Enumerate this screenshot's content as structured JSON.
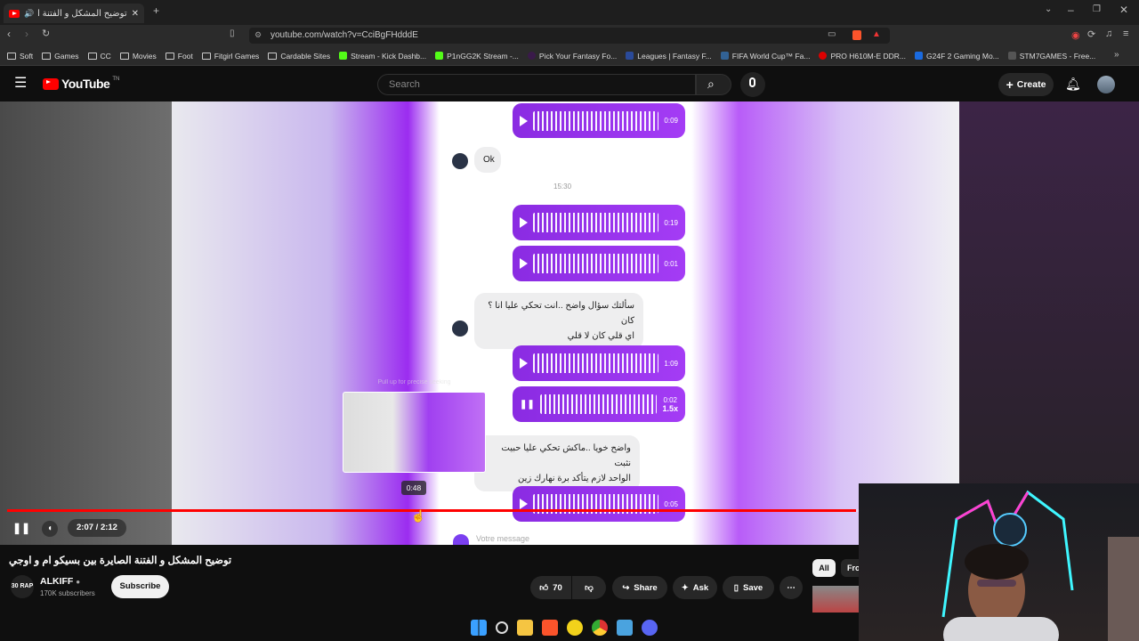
{
  "browser": {
    "tab_title": "توضيح المشكل و الفتنة الصايرة",
    "url": "youtube.com/watch?v=CciBgFHdddE",
    "bookmarks": [
      {
        "label": "Soft",
        "icon": "folder-icon"
      },
      {
        "label": "Games",
        "icon": "folder-icon"
      },
      {
        "label": "CC",
        "icon": "folder-icon"
      },
      {
        "label": "Movies",
        "icon": "folder-icon"
      },
      {
        "label": "Foot",
        "icon": "folder-icon"
      },
      {
        "label": "Fitgirl Games",
        "icon": "folder-icon"
      },
      {
        "label": "Cardable Sites",
        "icon": "folder-icon"
      },
      {
        "label": "Stream - Kick Dashb...",
        "icon": "kick-icon"
      },
      {
        "label": "P1nGG2K Stream -...",
        "icon": "kick-icon"
      },
      {
        "label": "Pick Your Fantasy Fo...",
        "icon": "site-icon"
      },
      {
        "label": "Leagues | Fantasy F...",
        "icon": "site-icon"
      },
      {
        "label": "FIFA World Cup™ Fa...",
        "icon": "fifa-icon"
      },
      {
        "label": "PRO H610M-E DDR...",
        "icon": "msi-icon"
      },
      {
        "label": "G24F 2 Gaming Mo...",
        "icon": "site-icon"
      },
      {
        "label": "STM7GAMES - Free...",
        "icon": "site-icon"
      }
    ]
  },
  "youtube": {
    "logo_text": "YouTube",
    "logo_region": "TN",
    "search_placeholder": "Search",
    "create_label": "Create"
  },
  "video": {
    "messages": {
      "audio_durations": [
        "0:09",
        "0:19",
        "0:01",
        "1:09",
        "0:02",
        "0:05"
      ],
      "speed": "1.5x",
      "ok_text": "Ok",
      "timestamp": "15:30",
      "msg1_line1": "سألتك سؤال واضح ..انت تحكي عليا انا ؟ كان",
      "msg1_line2": "اي قلي كان لا قلي",
      "msg2_line1": "واضح خويا ..ماكش تحكي عليا حبيت نثبت",
      "msg2_line2": "الواحد لازم يتأكد برة نهارك زين",
      "input_placeholder": "Votre message"
    },
    "preview_tip": "Pull up for precise seeking",
    "preview_time": "0:48",
    "time_display": "2:07 / 2:12",
    "progress_fraction": 0.755
  },
  "info": {
    "title": "توضيح المشكل و الفتنة الصايرة بين بسيكو ام و اوجي",
    "channel_name": "ALKIFF",
    "channel_avatar_text": "30 RAP",
    "subscribers": "170K subscribers",
    "subscribe_label": "Subscribe",
    "likes": "70",
    "share_label": "Share",
    "ask_label": "Ask",
    "save_label": "Save",
    "chip_all": "All",
    "chip_from": "Fro"
  },
  "colors": {
    "accent_red": "#ff0000",
    "bubble_purple": "#9a36ee"
  }
}
